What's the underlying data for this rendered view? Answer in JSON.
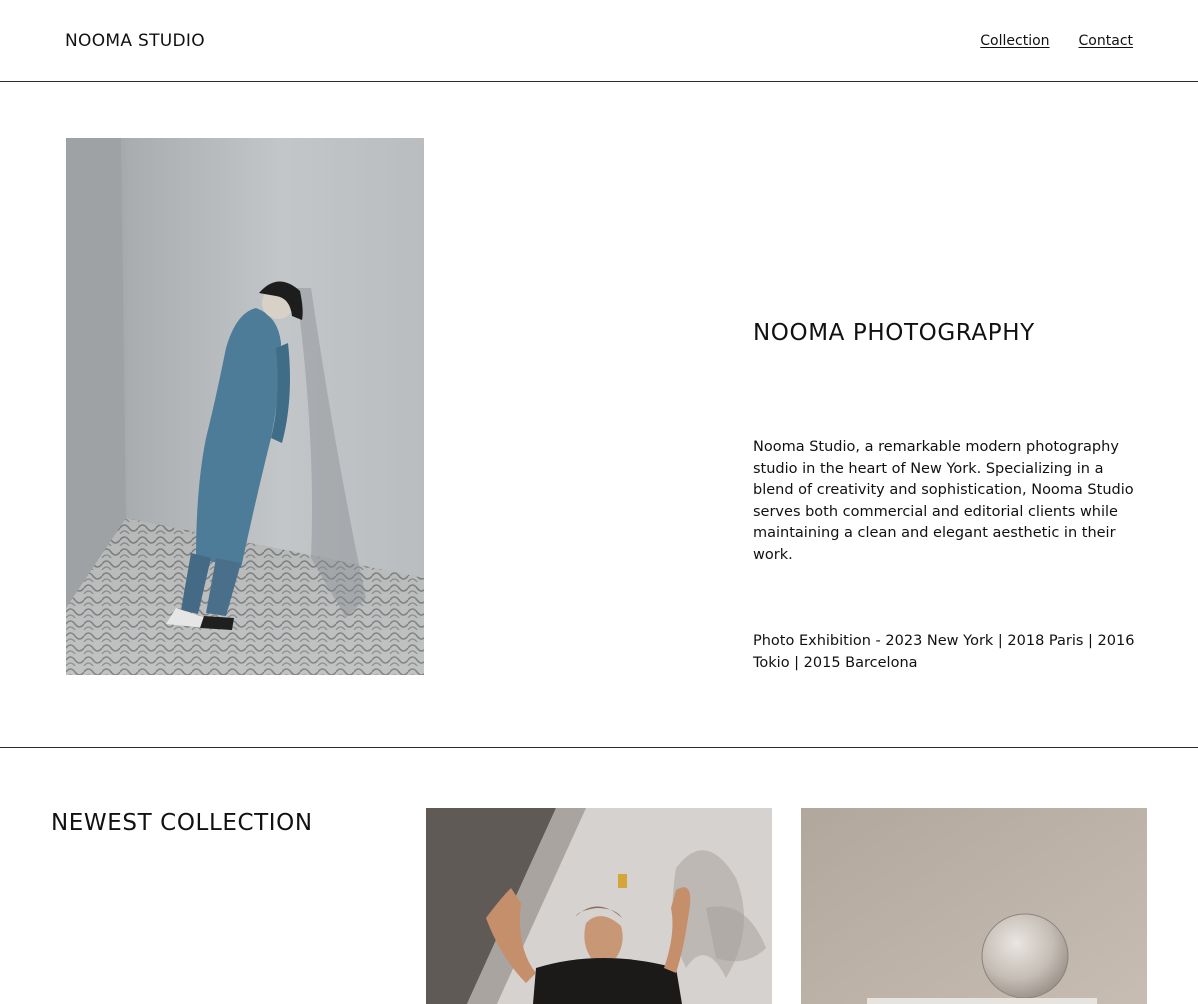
{
  "header": {
    "brand": "NOOMA STUDIO",
    "nav": [
      {
        "label": "Collection"
      },
      {
        "label": "Contact"
      }
    ]
  },
  "hero": {
    "title": "NOOMA PHOTOGRAPHY",
    "description": "Nooma Studio, a remarkable modern photography studio in the heart of New York. Specializing in a blend of creativity and sophistication, Nooma Studio serves both commercial and editorial clients while maintaining a clean and elegant aesthetic in their work.",
    "exhibition": "Photo Exhibition - 2023 New York | 2018 Paris | 2016 Tokio | 2015 Barcelona"
  },
  "collection": {
    "title": "NEWEST COLLECTION"
  }
}
